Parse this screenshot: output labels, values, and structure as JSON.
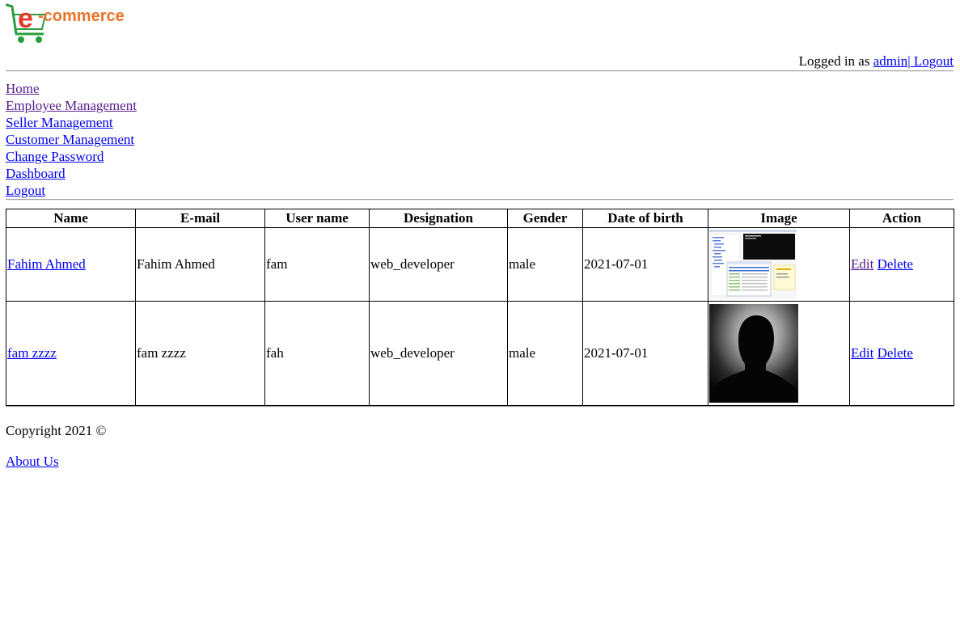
{
  "header": {
    "logo_text": "e-commerce",
    "logged_in_prefix": "Logged in as ",
    "username_link": "admin",
    "separator": "|",
    "logout_link": " Logout"
  },
  "nav": {
    "items": [
      {
        "label": "Home"
      },
      {
        "label": "Employee Management"
      },
      {
        "label": "Seller Management"
      },
      {
        "label": "Customer Management"
      },
      {
        "label": "Change Password"
      },
      {
        "label": "Dashboard"
      },
      {
        "label": "Logout"
      }
    ]
  },
  "table": {
    "columns": [
      "Name",
      "E-mail",
      "User name",
      "Designation",
      "Gender",
      "Date of birth",
      "Image",
      "Action"
    ],
    "rows": [
      {
        "name": "Fahim Ahmed",
        "email": "Fahim Ahmed",
        "username": "fam",
        "designation": "web_developer",
        "gender": "male",
        "dob": "2021-07-01",
        "image": "screenshot-thumbnail",
        "edit": "Edit",
        "delete": "Delete"
      },
      {
        "name": "fam zzzz",
        "email": "fam zzzz",
        "username": "fah",
        "designation": "web_developer",
        "gender": "male",
        "dob": "2021-07-01",
        "image": "person-silhouette",
        "edit": "Edit",
        "delete": "Delete"
      }
    ]
  },
  "footer": {
    "copyright": "Copyright 2021 ©",
    "about_link": "About Us"
  },
  "colors": {
    "link": "#0000ee",
    "visited_link": "#551a8b",
    "logo_green": "#2a9d3e",
    "logo_orange": "#e8742a",
    "logo_red": "#e23a2a"
  }
}
